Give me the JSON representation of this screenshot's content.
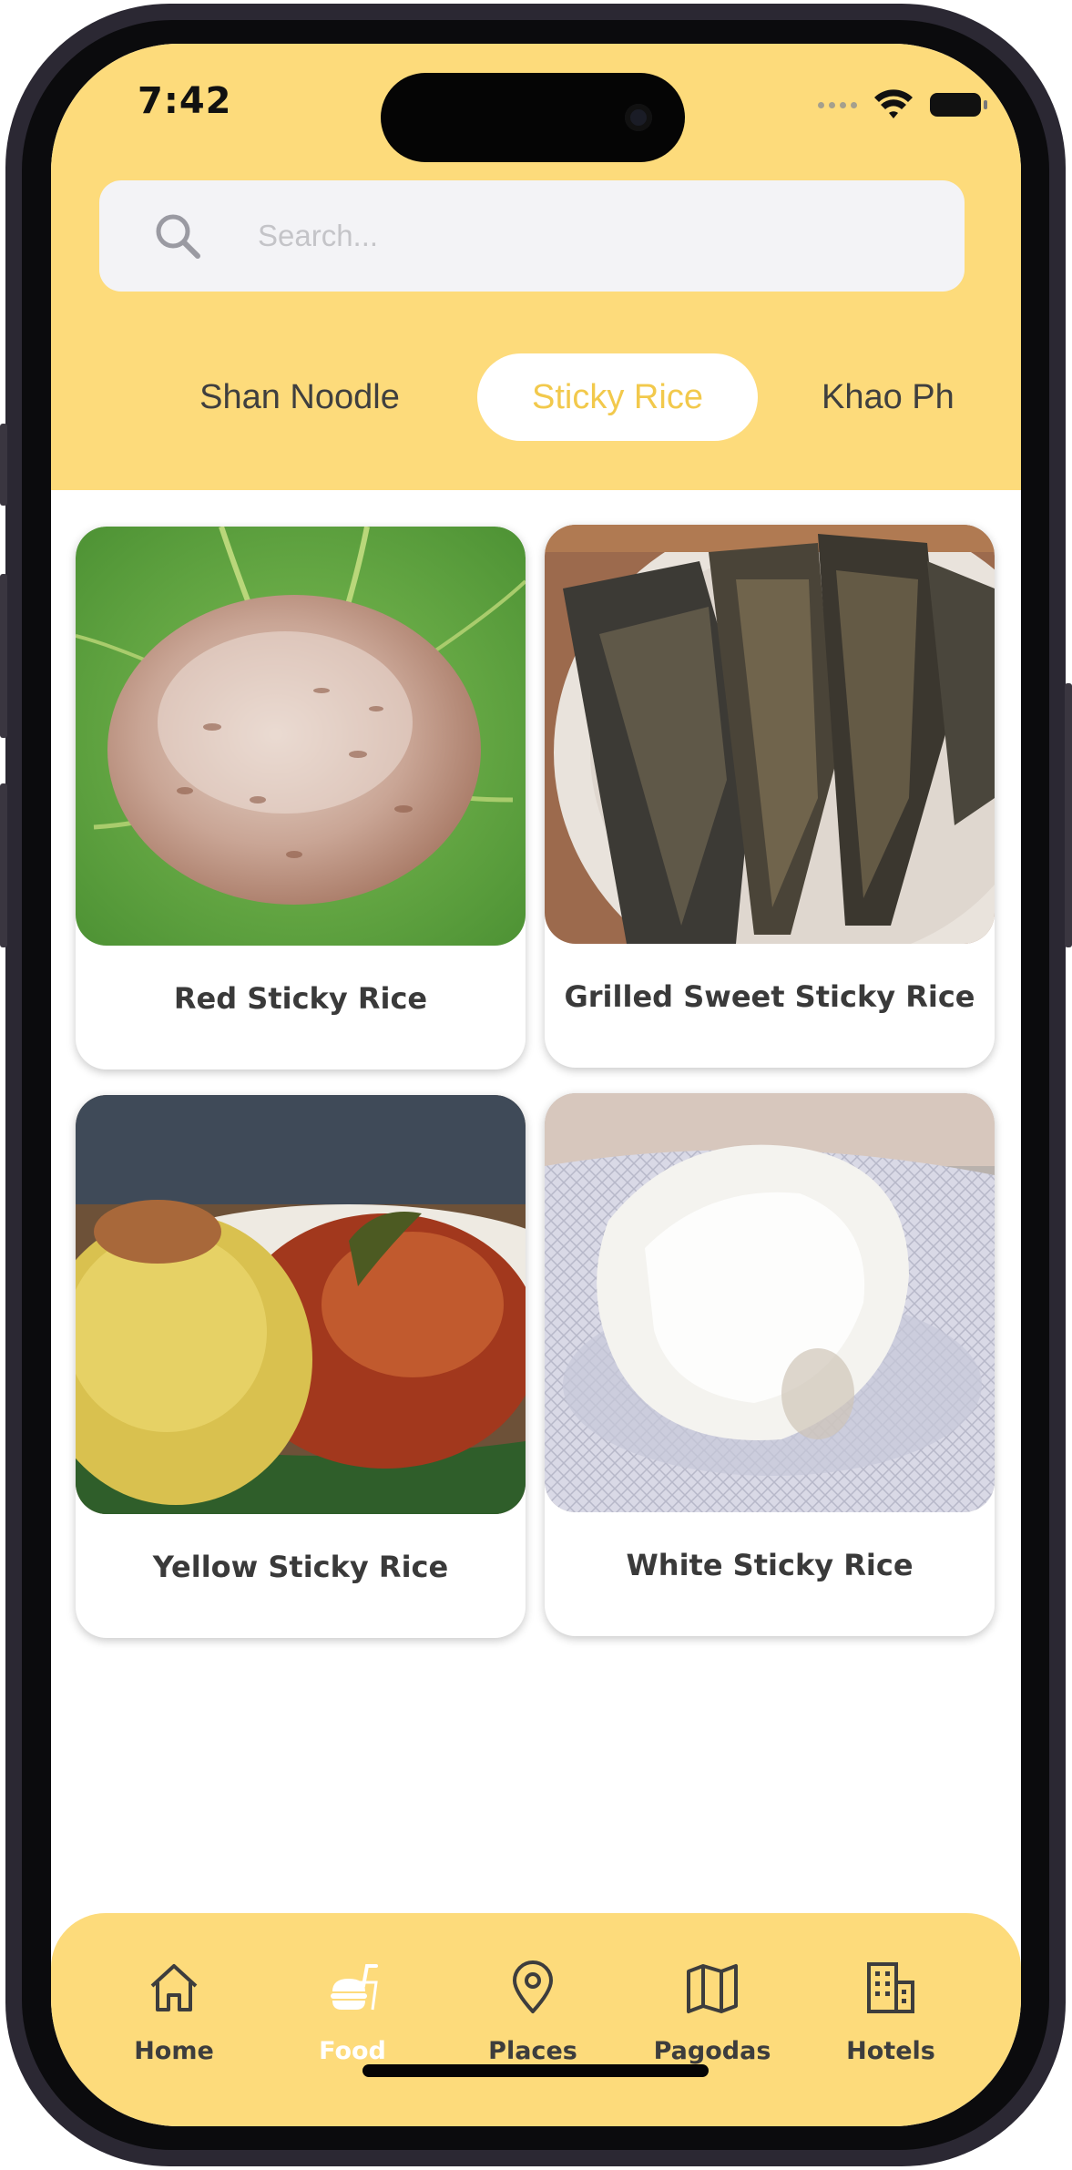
{
  "status_bar": {
    "time": "7:42"
  },
  "search": {
    "placeholder": "Search..."
  },
  "tabs": [
    {
      "label": "Shan Noodle",
      "active": false
    },
    {
      "label": "Sticky Rice",
      "active": true
    },
    {
      "label": "Khao Ph",
      "active": false
    }
  ],
  "items": [
    {
      "title": "Red Sticky Rice"
    },
    {
      "title": "Grilled Sweet Sticky Rice"
    },
    {
      "title": "Yellow Sticky Rice"
    },
    {
      "title": "White Sticky Rice"
    }
  ],
  "nav": [
    {
      "label": "Home",
      "icon": "home-icon",
      "active": false
    },
    {
      "label": "Food",
      "icon": "food-icon",
      "active": true
    },
    {
      "label": "Places",
      "icon": "map-pin-icon",
      "active": false
    },
    {
      "label": "Pagodas",
      "icon": "map-icon",
      "active": false
    },
    {
      "label": "Hotels",
      "icon": "building-icon",
      "active": false
    }
  ],
  "colors": {
    "header_bg": "#fddb7b",
    "active_tab_text": "#f2c94c",
    "text_dark": "#3a3a3a"
  }
}
